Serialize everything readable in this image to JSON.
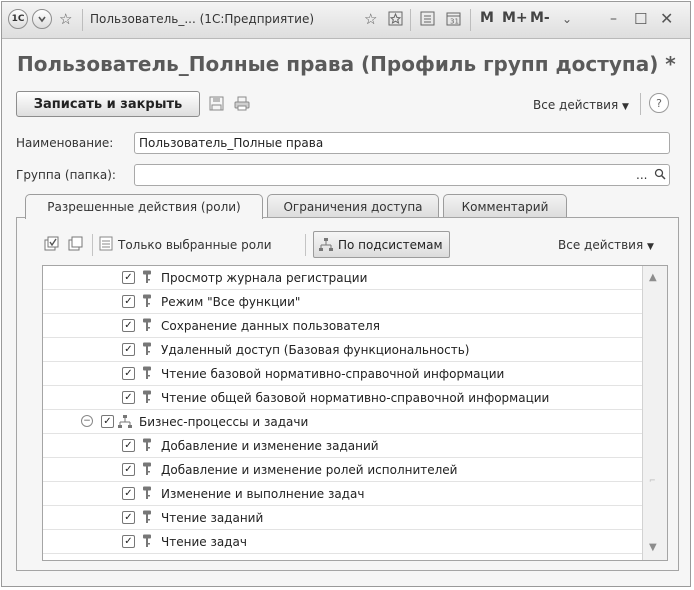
{
  "titlebar": {
    "title": "Пользователь_... (1С:Предприятие)",
    "app_icon": "1c-logo-icon",
    "m_label": "M",
    "mplus_label": "M+",
    "mminus_label": "M-"
  },
  "form": {
    "title": "Пользователь_Полные права (Профиль групп доступа) *"
  },
  "toolbar": {
    "save_close_label": "Записать и закрыть",
    "all_actions_label": "Все действия",
    "help_label": "?"
  },
  "fields": {
    "name_label": "Наименование:",
    "name_value": "Пользователь_Полные права",
    "group_label": "Группа (папка):",
    "group_value": "",
    "group_select": "...",
    "group_search": "Q"
  },
  "tabs": [
    {
      "label": "Разрешенные действия (роли)",
      "active": true
    },
    {
      "label": "Ограничения доступа",
      "active": false
    },
    {
      "label": "Комментарий",
      "active": false
    }
  ],
  "roles_toolbar": {
    "only_selected_label": "Только выбранные роли",
    "by_subsystems_label": "По подсистемам",
    "all_actions_label": "Все действия"
  },
  "rows": [
    {
      "text": "Просмотр журнала регистрации",
      "checked": true,
      "kind": "role"
    },
    {
      "text": "Режим \"Все функции\"",
      "checked": true,
      "kind": "role"
    },
    {
      "text": "Сохранение данных пользователя",
      "checked": true,
      "kind": "role"
    },
    {
      "text": "Удаленный доступ (Базовая функциональность)",
      "checked": true,
      "kind": "role"
    },
    {
      "text": "Чтение базовой нормативно-справочной информации",
      "checked": true,
      "kind": "role"
    },
    {
      "text": "Чтение общей базовой нормативно-справочной информации",
      "checked": true,
      "kind": "role"
    },
    {
      "text": "Бизнес-процессы и задачи",
      "checked": true,
      "kind": "group"
    },
    {
      "text": "Добавление и изменение заданий",
      "checked": true,
      "kind": "role"
    },
    {
      "text": "Добавление и изменение ролей исполнителей",
      "checked": true,
      "kind": "role"
    },
    {
      "text": "Изменение и выполнение задач",
      "checked": true,
      "kind": "role"
    },
    {
      "text": "Чтение заданий",
      "checked": true,
      "kind": "role"
    },
    {
      "text": "Чтение задач",
      "checked": true,
      "kind": "role"
    }
  ]
}
